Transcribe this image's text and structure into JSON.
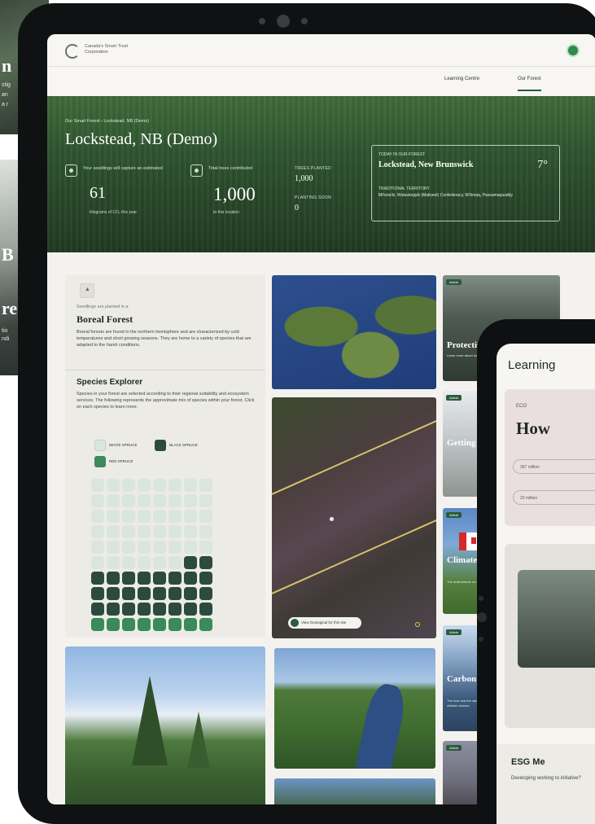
{
  "background": {
    "card1": {
      "big": "n",
      "lines": [
        "stig",
        "an",
        "a r"
      ]
    },
    "card2": {
      "big1": "B",
      "big2": "re",
      "lines": [
        "tio",
        "ndi"
      ]
    }
  },
  "site": {
    "logo_text": "Canada's Smart Trust Corporation",
    "nav": [
      "Learning Centre",
      "Our Forest"
    ]
  },
  "hero": {
    "breadcrumb": "Our Smart Forest  ›  Lockstead, NB (Demo)",
    "title": "Lockstead, NB (Demo)",
    "stat1": {
      "label": "Your seedlings will capture an estimated",
      "value": "61",
      "sub": "kilograms of CO₂ this year"
    },
    "stat2": {
      "label": "Total trees contributed",
      "value": "1,000",
      "sub": "to this location"
    },
    "trees_planted_head": "TREES PLANTED",
    "trees_planted_val": "1,000",
    "planting_soon_head": "PLANTING SOON",
    "planting_soon_val": "0",
    "location_box": {
      "head": "TODAY IN OUR FOREST",
      "place": "Lockstead, New Brunswick",
      "temp": "7°",
      "territory_head": "TRADITIONAL TERRITORY",
      "territory": "Mi'kma'ki, Wolastoqiyik (Maliseet) Confederacy, Mi'kmaq, Passamaquoddy"
    }
  },
  "forest": {
    "sub": "Seedlings are planted in a",
    "title": "Boreal Forest",
    "desc": "Boreal forests are found in the northern hemisphere and are characterized by cold temperatures and short growing seasons. They are home to a variety of species that are adapted to the harsh conditions.",
    "explorer_title": "Species Explorer",
    "explorer_desc": "Species in your forest are selected according to their regional suitability and ecosystem services. The following represents the approximate mix of species within your forest. Click on each species to learn more.",
    "legend": [
      {
        "label": "WHITE SPRUCE",
        "color": "#dbe5df"
      },
      {
        "label": "BLACK SPRUCE",
        "color": "#2d4a3e"
      },
      {
        "label": "RED SPRUCE",
        "color": "#3a8a5c"
      }
    ],
    "grid_counts": {
      "white": 46,
      "black": 26,
      "red": 8
    }
  },
  "map": {
    "button": "View Geological for this site"
  },
  "articles": [
    {
      "tag": "Article",
      "title": "Protecting",
      "desc": "Learn more about how forests protect"
    },
    {
      "tag": "Article",
      "title": "Getting to Nature",
      "desc": ""
    },
    {
      "tag": "Article",
      "title": "Climate Canadian",
      "desc": "The draft actions on climate"
    },
    {
      "tag": "Article",
      "title": "Carbon Sinks and Sinks",
      "desc": "The look and the carbon sinks and the result of climate choices"
    },
    {
      "tag": "Article",
      "title": "",
      "desc": ""
    }
  ],
  "phone": {
    "heading": "Learning",
    "card_tag": "ECO",
    "card_title": "How",
    "pill1": "367 million",
    "pill2": "20 million",
    "esg_title": "ESG Me",
    "esg_desc": "Developing working to initiative?"
  }
}
